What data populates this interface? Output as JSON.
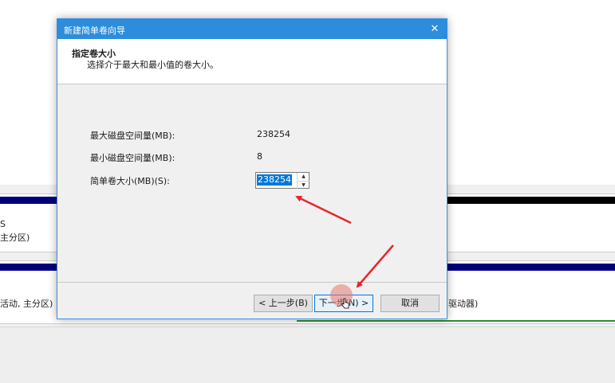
{
  "dialog": {
    "title": "新建简单卷向导",
    "close_glyph": "✕",
    "header_title": "指定卷大小",
    "header_subtitle": "选择介于最大和最小值的卷大小。",
    "max_label": "最大磁盘空间量(MB):",
    "max_value": "238254",
    "min_label": "最小磁盘空间量(MB):",
    "min_value": "8",
    "size_label": "简单卷大小(MB)(S):",
    "size_value": "238254",
    "buttons": {
      "back": "< 上一步(B)",
      "next": "下一步(N) >",
      "cancel": "取消"
    }
  },
  "background": {
    "row1_line1": "S",
    "row1_line2": "主分区)",
    "row2_left": "活动, 主分区)",
    "row2_right": "驱动器)"
  },
  "colors": {
    "titlebar": "#2b8ddb",
    "partition_bar": "#00007f",
    "selection": "#0078d7",
    "annotation_arrow": "#e8262a"
  },
  "icons": {
    "spin_up": "▲",
    "spin_down": "▼"
  }
}
